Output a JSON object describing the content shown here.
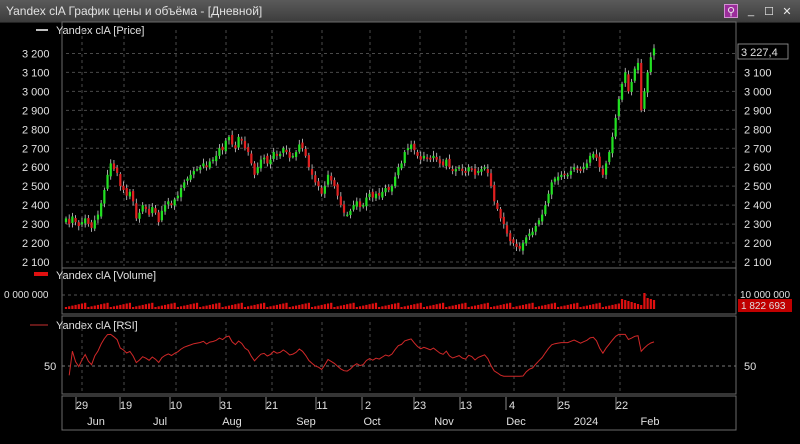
{
  "window": {
    "title": "Yandex clA График цены и объёма - [Дневной]"
  },
  "price_panel": {
    "legend": "Yandex clA [Price]",
    "last_value": "3 227,4",
    "y_ticks": [
      "3 200",
      "3 100",
      "3 000",
      "2 900",
      "2 800",
      "2 700",
      "2 600",
      "2 500",
      "2 400",
      "2 300",
      "2 200",
      "2 100"
    ]
  },
  "volume_panel": {
    "legend": "Yandex clA [Volume]",
    "left_tick": "0 000 000",
    "right_tick": "10 000 000",
    "last_value": "1 822 693"
  },
  "rsi_panel": {
    "legend": "Yandex clA [RSI]",
    "left_tick": "50",
    "right_tick": "50"
  },
  "x_axis": {
    "days": [
      "29",
      "19",
      "10",
      "31",
      "21",
      "11",
      "2",
      "23",
      "13",
      "4",
      "25",
      "22"
    ],
    "months": [
      "Jun",
      "Jul",
      "Aug",
      "Sep",
      "Oct",
      "Nov",
      "Dec",
      "2024",
      "Feb"
    ]
  },
  "chart_data": {
    "type": "candlestick",
    "title": "Yandex clA",
    "price_ylim": [
      2100,
      3250
    ],
    "volume_ymax": 10000000,
    "rsi_ylim": [
      0,
      100
    ],
    "rsi_ref": 50,
    "last_price": 3227.4,
    "last_volume": 1822693,
    "close": [
      2330,
      2300,
      2340,
      2310,
      2290,
      2310,
      2330,
      2300,
      2280,
      2320,
      2350,
      2410,
      2480,
      2560,
      2620,
      2590,
      2570,
      2500,
      2480,
      2450,
      2470,
      2420,
      2330,
      2360,
      2400,
      2380,
      2350,
      2390,
      2360,
      2310,
      2370,
      2400,
      2420,
      2400,
      2430,
      2450,
      2490,
      2520,
      2540,
      2560,
      2580,
      2590,
      2600,
      2620,
      2600,
      2630,
      2640,
      2660,
      2700,
      2690,
      2740,
      2760,
      2720,
      2700,
      2760,
      2740,
      2700,
      2680,
      2620,
      2560,
      2600,
      2640,
      2650,
      2620,
      2640,
      2680,
      2660,
      2670,
      2700,
      2680,
      2650,
      2660,
      2680,
      2720,
      2700,
      2660,
      2600,
      2560,
      2520,
      2500,
      2460,
      2500,
      2560,
      2530,
      2500,
      2450,
      2400,
      2360,
      2350,
      2370,
      2400,
      2420,
      2390,
      2400,
      2440,
      2460,
      2440,
      2460,
      2450,
      2470,
      2490,
      2480,
      2500,
      2550,
      2600,
      2620,
      2680,
      2700,
      2720,
      2690,
      2660,
      2640,
      2660,
      2650,
      2640,
      2660,
      2640,
      2620,
      2610,
      2640,
      2600,
      2580,
      2590,
      2600,
      2580,
      2570,
      2600,
      2590,
      2560,
      2580,
      2590,
      2600,
      2570,
      2500,
      2420,
      2380,
      2330,
      2300,
      2250,
      2210,
      2200,
      2180,
      2170,
      2200,
      2230,
      2250,
      2260,
      2290,
      2320,
      2350,
      2400,
      2460,
      2520,
      2540,
      2550,
      2560,
      2560,
      2560,
      2580,
      2600,
      2590,
      2580,
      2600,
      2620,
      2660,
      2670,
      2650,
      2600,
      2560,
      2620,
      2680,
      2760,
      2860,
      2960,
      3040,
      3100,
      3000,
      3050,
      3120,
      3150,
      2900,
      3000,
      3100,
      3180,
      3227
    ]
  }
}
